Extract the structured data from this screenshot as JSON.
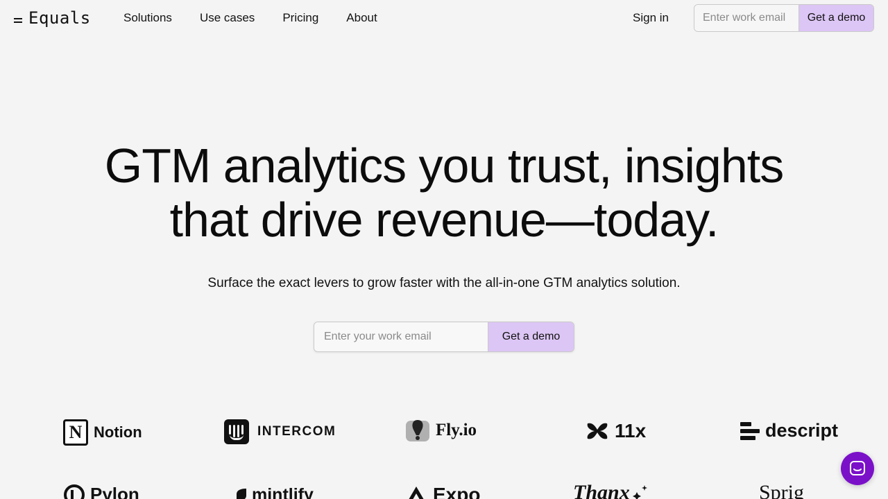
{
  "brand": {
    "name": "Equals"
  },
  "nav": {
    "links": [
      "Solutions",
      "Use cases",
      "Pricing",
      "About"
    ],
    "sign_in": "Sign in",
    "email_placeholder": "Enter work email",
    "cta": "Get a demo"
  },
  "hero": {
    "title_line1": "GTM analytics you trust, insights",
    "title_line2": "that drive revenue—today.",
    "subtitle": "Surface the exact levers to grow faster with the all-in-one GTM analytics solution.",
    "email_placeholder": "Enter your work email",
    "cta": "Get a demo"
  },
  "logos": {
    "row1": [
      "Notion",
      "INTERCOM",
      "Fly.io",
      "11x",
      "descript"
    ],
    "row2": [
      "Pylon",
      "mintlify",
      "Expo",
      "Thanx",
      "Sprig"
    ]
  },
  "colors": {
    "accent": "#dcc6f5",
    "chat": "#7b10c9",
    "background": "#f4f4f4"
  },
  "icons": {
    "chat": "chat-bubble-icon"
  }
}
